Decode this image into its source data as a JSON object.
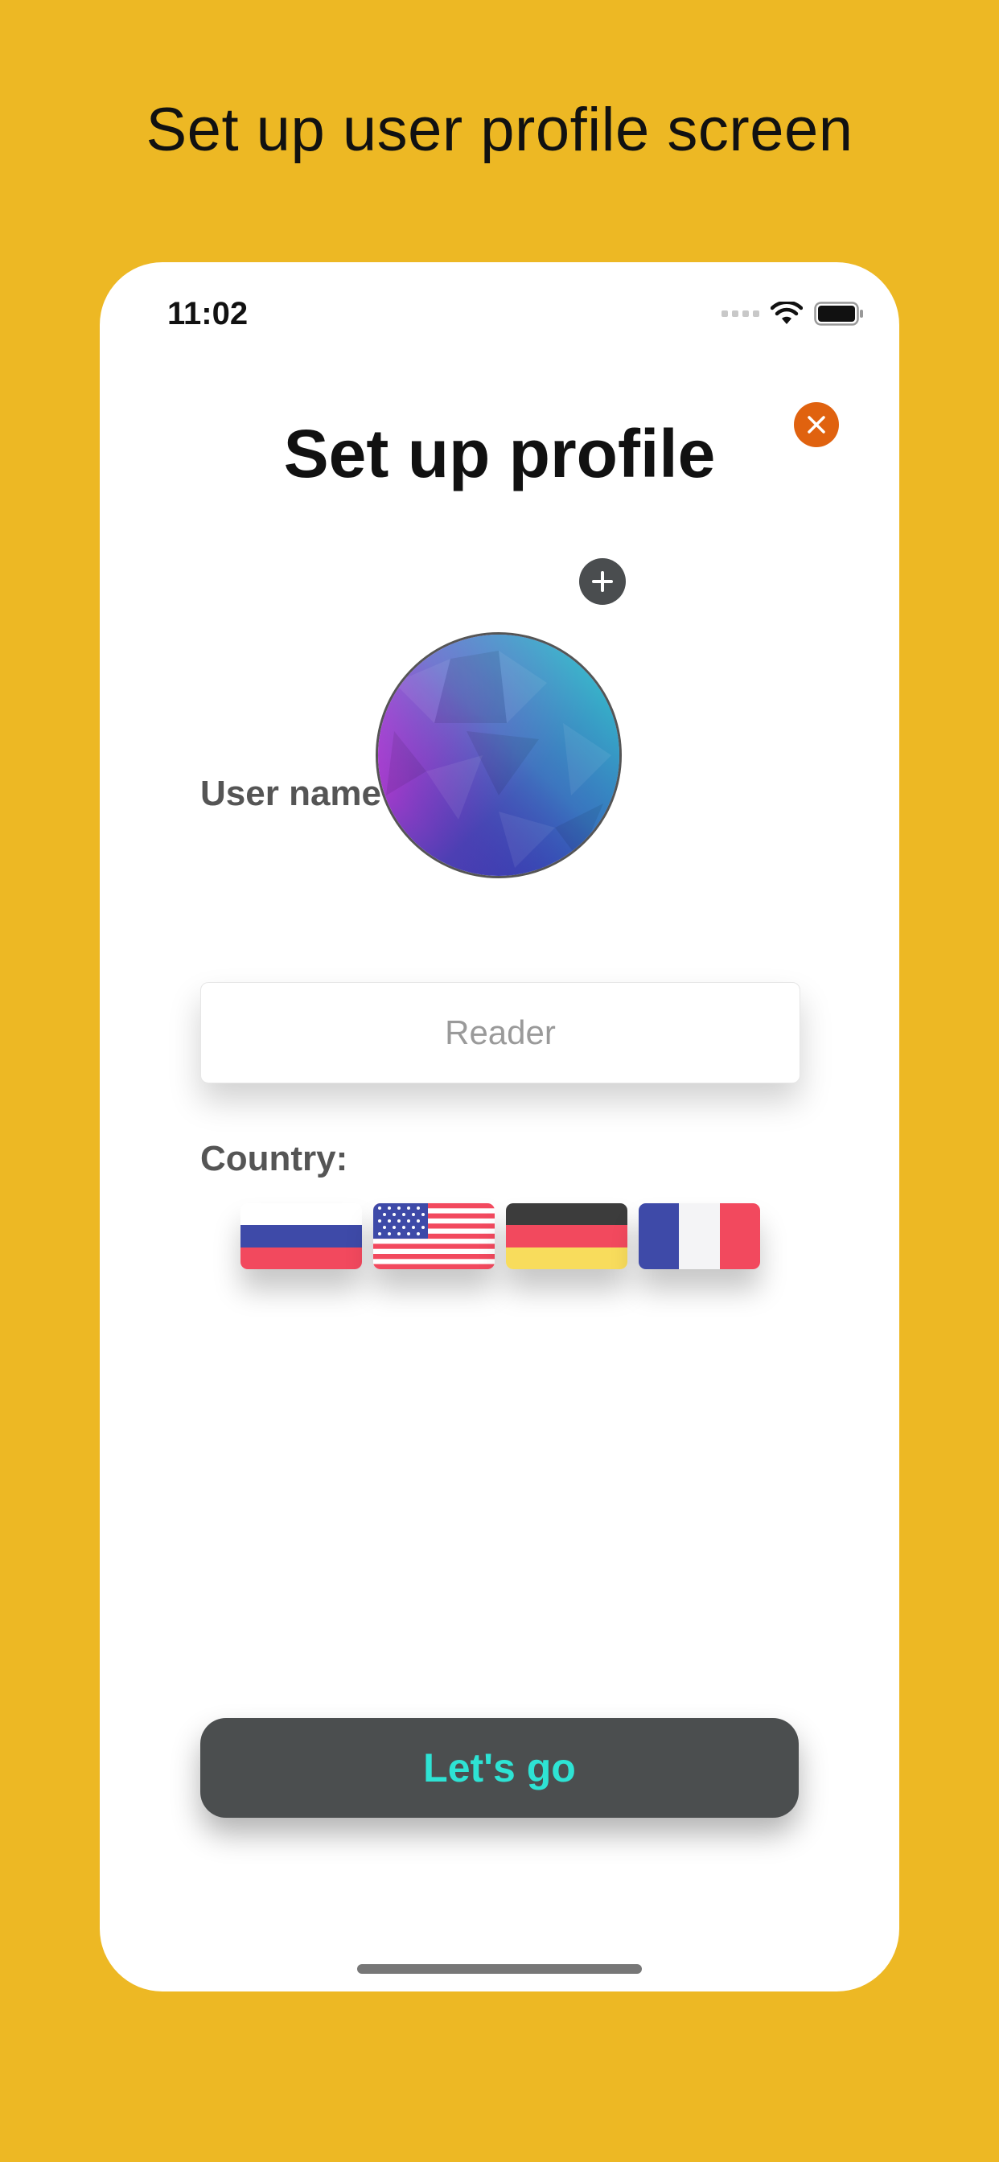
{
  "caption": "Set up user profile screen",
  "status_bar": {
    "time": "11:02"
  },
  "screen": {
    "title": "Set up profile",
    "username_label": "User name",
    "username_placeholder": "Reader",
    "country_label": "Country:",
    "countries": [
      {
        "name": "russia-flag",
        "colors": [
          "#ffffff",
          "#3E4AA8",
          "#F2495E"
        ]
      },
      {
        "name": "usa-flag",
        "colors": [
          "#F2495E",
          "#ffffff",
          "#3E4AA8"
        ]
      },
      {
        "name": "germany-flag",
        "colors": [
          "#3c3c3c",
          "#F2495E",
          "#F8DC5C"
        ]
      },
      {
        "name": "france-flag",
        "colors": [
          "#3E4AA8",
          "#ffffff",
          "#F2495E"
        ]
      }
    ],
    "submit_label": "Let's go"
  },
  "colors": {
    "background": "#EDB824",
    "close_button": "#E0620F",
    "submit_button": "#4B4E4F",
    "submit_text": "#2EE3D4"
  },
  "icons": [
    "close-icon",
    "plus-icon",
    "wifi-icon",
    "battery-icon",
    "signal-icon"
  ]
}
